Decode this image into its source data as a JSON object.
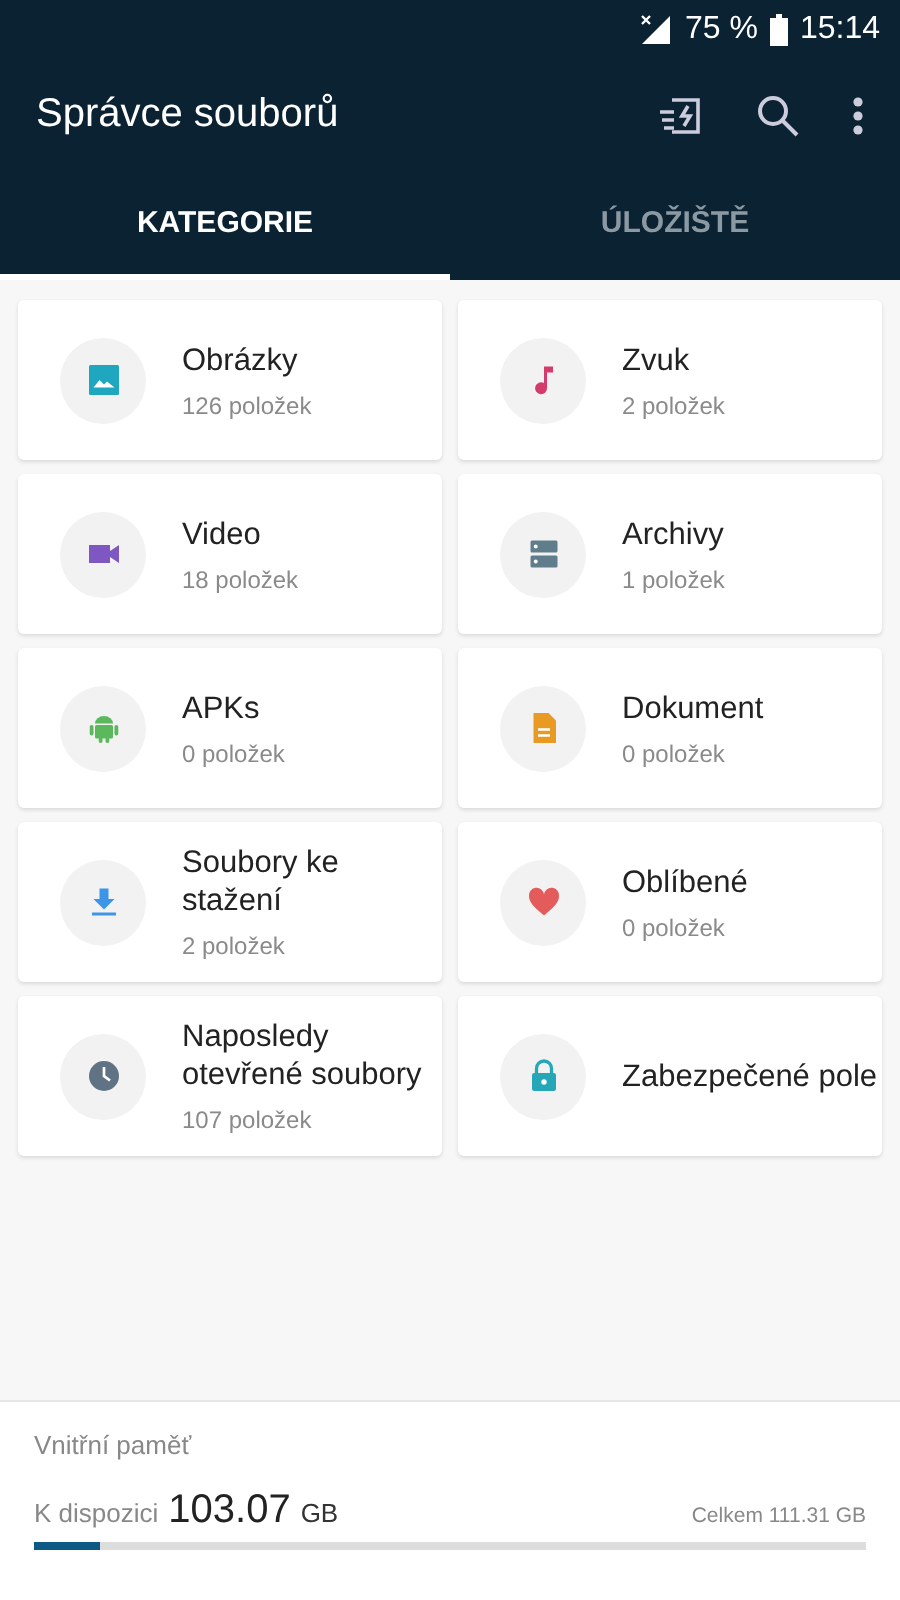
{
  "status_bar": {
    "battery": "75 %",
    "time": "15:14"
  },
  "app_bar": {
    "title": "Správce souborů"
  },
  "tabs": [
    {
      "label": "KATEGORIE",
      "selected": true
    },
    {
      "label": "ÚLOŽIŠTĚ",
      "selected": false
    }
  ],
  "categories": [
    {
      "kind": "image",
      "name": "Obrázky",
      "count": "126 položek",
      "color": "#1ea7bf"
    },
    {
      "kind": "music",
      "name": "Zvuk",
      "count": "2 položek",
      "color": "#d43b6b"
    },
    {
      "kind": "video",
      "name": "Video",
      "count": "18 položek",
      "color": "#7e57c2"
    },
    {
      "kind": "archive",
      "name": "Archivy",
      "count": "1 položek",
      "color": "#607d8b"
    },
    {
      "kind": "android",
      "name": "APKs",
      "count": "0 položek",
      "color": "#5cb85c"
    },
    {
      "kind": "document",
      "name": "Dokument",
      "count": "0 položek",
      "color": "#e89a22"
    },
    {
      "kind": "download",
      "name": "Soubory ke stažení",
      "count": "2 položek",
      "color": "#3d95e8"
    },
    {
      "kind": "heart",
      "name": "Oblíbené",
      "count": "0 položek",
      "color": "#e35b5b"
    },
    {
      "kind": "clock",
      "name": "Naposledy otevřené soubory",
      "count": "107 položek",
      "color": "#5f7384"
    },
    {
      "kind": "lock",
      "name": "Zabezpečené pole",
      "color": "#26a7b8"
    }
  ],
  "storage": {
    "title": "Vnitřní paměť",
    "available_label": "K dispozici",
    "available_value": "103.07",
    "available_unit": "GB",
    "total": "Celkem 111.31 GB",
    "level": 0.08
  }
}
